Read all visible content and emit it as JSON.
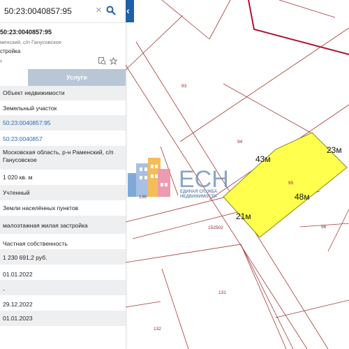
{
  "search": {
    "value": "50:23:0040857:95",
    "clear_icon": "×"
  },
  "object": {
    "title": "50:23:0040857:95",
    "address_short": "менский, с/п Ганусовское",
    "usage_short": "стройка"
  },
  "tabs": {
    "left_label": "",
    "services_label": "Услуги"
  },
  "info_rows": [
    {
      "text": "Объект недвижимости",
      "link": false
    },
    {
      "text": "Земельный участок",
      "link": false
    },
    {
      "text": "50:23:0040857:95",
      "link": true
    },
    {
      "text": "50:23:0040857",
      "link": true
    },
    {
      "text": "Московская область, р-н Раменский, с/п Ганусовское",
      "link": false
    },
    {
      "text": "1 020 кв. м",
      "link": false
    },
    {
      "text": "Учтенный",
      "link": false
    },
    {
      "text": "Земли населённых пунктов",
      "link": false
    },
    {
      "text": "малоэтажная жилая застройка",
      "link": false
    },
    {
      "text": "Частная собственность",
      "link": false
    },
    {
      "text": "1 230 691,2 руб.",
      "link": false
    },
    {
      "text": "01.01.2022",
      "link": false
    },
    {
      "text": "-",
      "link": false
    },
    {
      "text": "29.12.2022",
      "link": false
    },
    {
      "text": "01.01.2023",
      "link": false
    }
  ],
  "map": {
    "parcel_labels": [
      "93",
      "94",
      "95",
      "96",
      "136",
      "152502",
      "131",
      "132"
    ],
    "dimensions": [
      "43м",
      "23м",
      "48м",
      "21м"
    ],
    "watermark": {
      "main": "ЕСН",
      "line1": "ЕДИНАЯ СЛУЖБА",
      "line2": "НЕДВИЖИМОСТИ"
    },
    "colors": {
      "selected_fill": "#ffff4d",
      "parcel_border": "#a33a3a",
      "boundary": "#b01030",
      "accent": "#1f5fa6"
    }
  }
}
